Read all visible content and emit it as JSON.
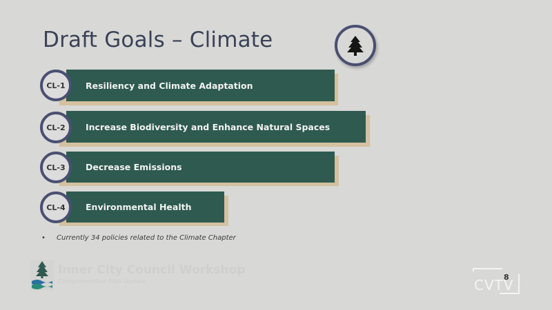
{
  "slide": {
    "title": "Draft Goals – Climate",
    "badge_icon": "pine-tree-icon",
    "goals": [
      {
        "code": "CL-1",
        "label": "Resiliency and Climate Adaptation"
      },
      {
        "code": "CL-2",
        "label": "Increase Biodiversity and Enhance Natural Spaces"
      },
      {
        "code": "CL-3",
        "label": "Decrease Emissions"
      },
      {
        "code": "CL-4",
        "label": "Environmental Health"
      }
    ],
    "bullet": "•",
    "note": "Currently 34 policies related to the Climate Chapter",
    "page_number": "8"
  },
  "footer": {
    "logo_icon": "tree-wave-logo-icon",
    "watermark_title": "Inner City Council Workshop",
    "watermark_sub": "Comprehensive Plan Update",
    "broadcast_logo": "CVTV"
  },
  "colors": {
    "bar": "#2e5a4f",
    "bar_shadow": "#d3c1a0",
    "circle_border": "#4a4f72",
    "title": "#3a4257",
    "background": "#d8d8d6"
  }
}
